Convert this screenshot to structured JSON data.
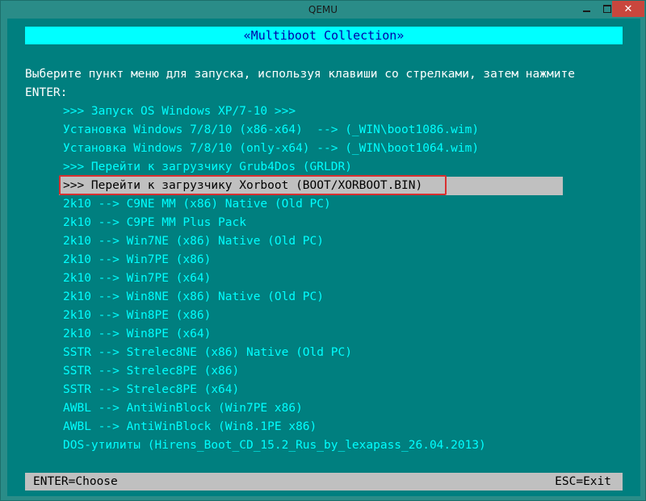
{
  "window": {
    "title": "QEMU",
    "controls": {
      "close_glyph": "✕"
    }
  },
  "header": {
    "title": "«Multiboot Collection»"
  },
  "prompt": {
    "line1": "Выберите пункт меню для запуска, используя клавиши со стрелками, затем нажмите",
    "line2": "ENTER:"
  },
  "menu": {
    "selected_index": 4,
    "items": [
      ">>> Запуск OS Windows XP/7-10 >>>",
      "Установка Windows 7/8/10 (x86-x64)  --> (_WIN\\boot1086.wim)",
      "Установка Windows 7/8/10 (only-x64) --> (_WIN\\boot1064.wim)",
      ">>> Перейти к загрузчику Grub4Dos (GRLDR)",
      ">>> Перейти к загрузчику Xorboot (BOOT/XORBOOT.BIN)",
      "2k10 --> C9NE MM (x86) Native (Old PC)",
      "2k10 --> C9PE MM Plus Pack",
      "2k10 --> Win7NE (x86) Native (Old PC)",
      "2k10 --> Win7PE (x86)",
      "2k10 --> Win7PE (x64)",
      "2k10 --> Win8NE (x86) Native (Old PC)",
      "2k10 --> Win8PE (x86)",
      "2k10 --> Win8PE (x64)",
      "SSTR --> Strelec8NE (x86) Native (Old PC)",
      "SSTR --> Strelec8PE (x86)",
      "SSTR --> Strelec8PE (x64)",
      "AWBL --> AntiWinBlock (Win7PE x86)",
      "AWBL --> AntiWinBlock (Win8.1PE x86)",
      "DOS-утилиты (Hirens_Boot_CD_15.2_Rus_by_lexapass_26.04.2013)"
    ]
  },
  "footer": {
    "left": "ENTER=Choose",
    "right": "ESC=Exit"
  },
  "colors": {
    "background": "#007f7f",
    "header_bg": "#00ffff",
    "header_text": "#0000aa",
    "menu_text": "#00ffff",
    "selected_bg": "#c0c0c0",
    "selection_outline": "#d83030"
  }
}
